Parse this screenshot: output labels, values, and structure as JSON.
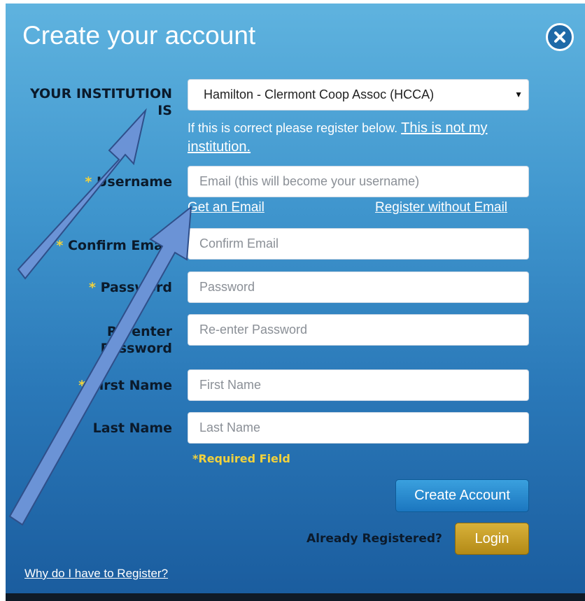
{
  "dialog": {
    "title": "Create your account",
    "close_icon": "close-icon"
  },
  "institution": {
    "label": "YOUR INSTITUTION IS",
    "selected": "Hamilton - Clermont Coop Assoc (HCCA)",
    "note_text": "If this is correct please register below.",
    "not_my_link": "This is not my institution."
  },
  "form": {
    "username": {
      "star": "*",
      "label": "Username",
      "placeholder": "Email (this will become your username)"
    },
    "get_email_link": "Get an Email",
    "register_without_email_link": "Register without Email",
    "confirm_email": {
      "star": "*",
      "label": "Confirm Email",
      "placeholder": "Confirm Email"
    },
    "password": {
      "star": "*",
      "label": "Password",
      "placeholder": "Password"
    },
    "reenter_password": {
      "label_line1": "Re-enter",
      "label_line2": "Password",
      "placeholder": "Re-enter Password"
    },
    "first_name": {
      "star": "*",
      "label": "First Name",
      "placeholder": "First Name"
    },
    "last_name": {
      "label": "Last Name",
      "placeholder": "Last Name"
    },
    "required_note": "*Required Field"
  },
  "actions": {
    "create_account": "Create Account",
    "already_registered": "Already Registered?",
    "login": "Login",
    "why_register": "Why do I have to Register?"
  },
  "colors": {
    "gradient_top": "#5fb3df",
    "gradient_bottom": "#1a5c9e",
    "required_star": "#f2d23c",
    "login_gold": "#c9a02a",
    "arrow_fill": "#6b93d6"
  }
}
